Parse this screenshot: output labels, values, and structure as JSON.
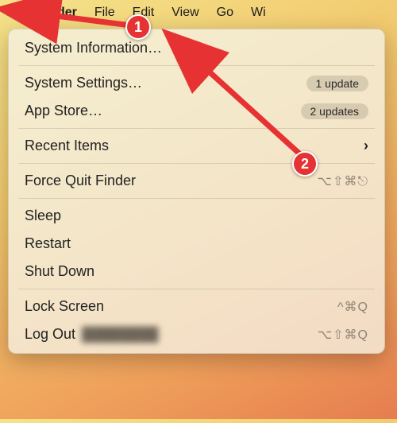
{
  "menubar": {
    "apple_glyph": "",
    "items": [
      "Finder",
      "File",
      "Edit",
      "View",
      "Go",
      "Wi"
    ]
  },
  "menu": {
    "system_info": "System Information…",
    "system_settings": {
      "label": "System Settings…",
      "badge": "1 update"
    },
    "app_store": {
      "label": "App Store…",
      "badge": "2 updates"
    },
    "recent_items": {
      "label": "Recent Items",
      "chevron": "›"
    },
    "force_quit": {
      "label": "Force Quit Finder",
      "shortcut": "⌥⇧⌘⎋"
    },
    "sleep": "Sleep",
    "restart": "Restart",
    "shut_down": "Shut Down",
    "lock_screen": {
      "label": "Lock Screen",
      "shortcut": "^⌘Q"
    },
    "log_out": {
      "label": "Log Out",
      "username_redacted": "████████",
      "shortcut": "⌥⇧⌘Q"
    }
  },
  "annotations": {
    "badge1": "1",
    "badge2": "2"
  }
}
